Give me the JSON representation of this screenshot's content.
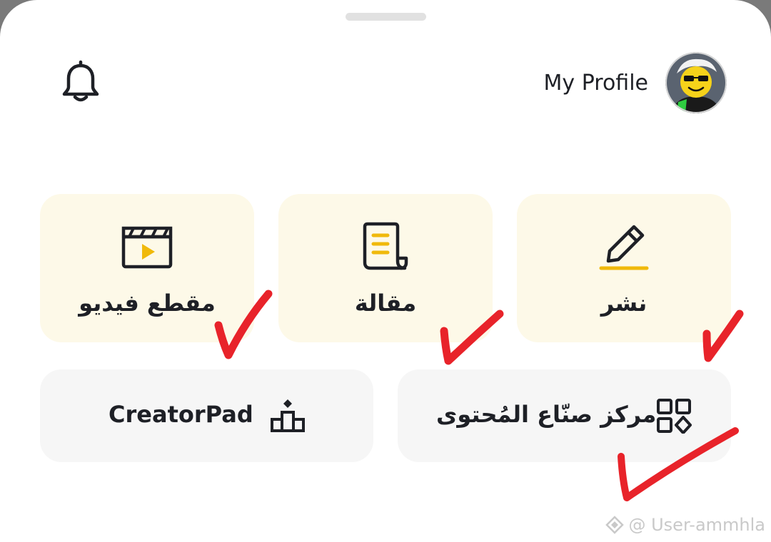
{
  "header": {
    "profile_label": "My Profile",
    "bell_icon": "bell-icon",
    "avatar_icon": "avatar"
  },
  "tiles": [
    {
      "label": "مقطع فيديو",
      "icon": "video-clip-icon"
    },
    {
      "label": "مقالة",
      "icon": "article-icon"
    },
    {
      "label": "نشر",
      "icon": "pencil-icon"
    }
  ],
  "wide_tiles": [
    {
      "label": "CreatorPad",
      "icon": "podium-icon"
    },
    {
      "label": "مركز صنّاع المُحتوى",
      "icon": "grid-apps-icon"
    }
  ],
  "colors": {
    "tile_yellow": "#fdf9e8",
    "tile_gray": "#f6f6f6",
    "accent": "#f0b90b",
    "text": "#1e2026",
    "check_mark": "#e8232a"
  },
  "watermark": "@ User-ammhla"
}
